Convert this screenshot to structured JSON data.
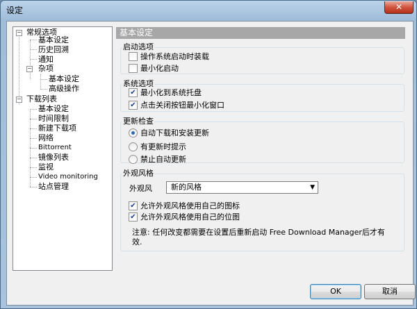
{
  "window": {
    "title": "设定",
    "close_label": "✕"
  },
  "tree": {
    "items": [
      {
        "label": "常规选项"
      },
      {
        "label": "基本设定"
      },
      {
        "label": "历史回溯"
      },
      {
        "label": "通知"
      },
      {
        "label": "杂项"
      },
      {
        "label": "基本设定"
      },
      {
        "label": "高级操作"
      },
      {
        "label": "下载列表"
      },
      {
        "label": "基本设定"
      },
      {
        "label": "时间限制"
      },
      {
        "label": "新建下载项"
      },
      {
        "label": "网络"
      },
      {
        "label": "Bittorrent"
      },
      {
        "label": "镜像列表"
      },
      {
        "label": "监视"
      },
      {
        "label": "Video monitoring"
      },
      {
        "label": "站点管理"
      }
    ],
    "expanded_symbol": "−"
  },
  "panel": {
    "header": "基本设定",
    "startup": {
      "title": "启动选项",
      "options": [
        {
          "label": "操作系统启动时装载",
          "checked": false
        },
        {
          "label": "最小化启动",
          "checked": false
        }
      ]
    },
    "system": {
      "title": "系统选项",
      "options": [
        {
          "label": "最小化到系统托盘",
          "checked": true
        },
        {
          "label": "点击关闭按钮最小化窗口",
          "checked": true
        }
      ]
    },
    "update": {
      "title": "更新检查",
      "options": [
        {
          "label": "自动下载和安装更新",
          "selected": true
        },
        {
          "label": "有更新时提示",
          "selected": false
        },
        {
          "label": "禁止自动更新",
          "selected": false
        }
      ]
    },
    "skin": {
      "title": "外观风格",
      "label": "外观风",
      "selected": "新的风格",
      "options": [
        {
          "label": "允许外观风格使用自己的图标",
          "checked": true
        },
        {
          "label": "允许外观风格使用自己的位图",
          "checked": true
        }
      ],
      "note": "注意: 任何改变都需要在设置后重新启动 Free Download Manager后才有效."
    }
  },
  "buttons": {
    "ok": "OK",
    "cancel": "取消"
  },
  "icons": {
    "check": "✔",
    "dropdown": "▼"
  }
}
